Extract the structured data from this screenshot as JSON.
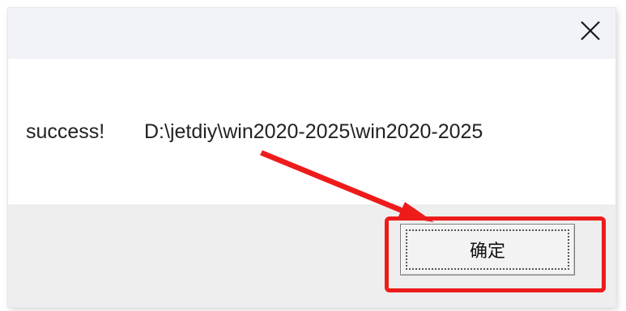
{
  "dialog": {
    "close_glyph": "✕",
    "message_status": "success!",
    "message_path": "D:\\jetdiy\\win2020-2025\\win2020-2025",
    "ok_label": "确定"
  },
  "annotation": {
    "color": "#ee1b1b"
  }
}
